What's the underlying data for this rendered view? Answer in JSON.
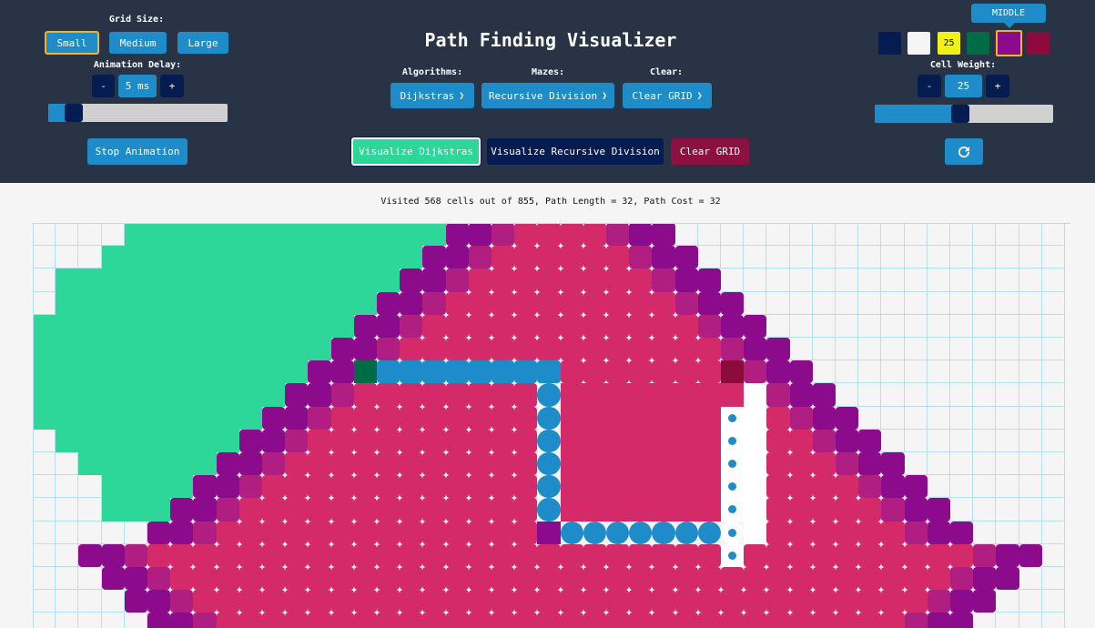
{
  "app": {
    "title": "Path Finding Visualizer"
  },
  "grid_size": {
    "label": "Grid Size:",
    "options": [
      "Small",
      "Medium",
      "Large"
    ],
    "selected": "Small"
  },
  "animation_delay": {
    "label": "Animation Delay:",
    "minus": "-",
    "value": "5 ms",
    "plus": "+",
    "slider_fraction": 0.12
  },
  "stop_animation": "Stop Animation",
  "menus": {
    "algorithms": {
      "label": "Algorithms:",
      "value": "Dijkstras"
    },
    "mazes": {
      "label": "Mazes:",
      "value": "Recursive Division"
    },
    "clear": {
      "label": "Clear:",
      "value": "Clear GRID"
    }
  },
  "actions": {
    "visualize": "Visualize Dijkstras",
    "maze": "Visualize Recursive Division",
    "clear": "Clear GRID"
  },
  "palette": {
    "tooltip": "MIDDLE",
    "swatches": [
      {
        "name": "start",
        "color": "#051c50",
        "text": ""
      },
      {
        "name": "empty",
        "color": "#f5f5f5",
        "text": ""
      },
      {
        "name": "weight",
        "color": "#f0f01a",
        "text": "25"
      },
      {
        "name": "target",
        "color": "#006b45",
        "text": ""
      },
      {
        "name": "middle",
        "color": "#8c0a8c",
        "text": ""
      },
      {
        "name": "end",
        "color": "#8c0a3c",
        "text": ""
      }
    ],
    "selected": "middle"
  },
  "cell_weight": {
    "label": "Cell Weight:",
    "minus": "-",
    "value": "25",
    "plus": "+",
    "slider_fraction": 0.48
  },
  "reset_icon": "refresh-icon",
  "status": "Visited 568 cells out of 855, Path Length = 32, Path Cost = 32",
  "colors": {
    "topbar": "#283446",
    "accent": "#1e8cc8",
    "visited_green": "#2dd699",
    "visited_pink": "#d52a6a",
    "visited_magenta": "#b01e82",
    "frontier_purple": "#8c0a8c",
    "path_blue": "#1e8cc8",
    "wall_border": "#b6dff0"
  },
  "grid": {
    "cols": 45,
    "visible_rows": 18,
    "green_rows": [
      [
        0,
        19
      ],
      [
        0,
        18
      ],
      [
        0,
        17
      ],
      [
        0,
        16
      ],
      [
        0,
        15
      ],
      [
        0,
        14
      ],
      [
        0,
        13
      ],
      [
        0,
        12
      ],
      [
        0,
        11
      ],
      [
        0,
        10
      ],
      [
        0,
        9
      ],
      [
        0,
        8
      ],
      [
        0,
        7
      ],
      [
        0,
        6
      ],
      [
        0,
        5
      ],
      [
        0,
        4
      ],
      [
        0,
        3
      ],
      [
        0,
        2
      ]
    ],
    "green_left_cut": [
      4,
      3,
      1,
      1,
      0,
      0,
      0,
      0,
      0,
      1,
      2,
      3,
      3,
      5,
      5,
      7,
      8,
      9
    ],
    "path_dots": [
      [
        8,
        30
      ],
      [
        9,
        30
      ],
      [
        10,
        30
      ],
      [
        11,
        30
      ],
      [
        12,
        30
      ],
      [
        13,
        30
      ],
      [
        14,
        30
      ]
    ],
    "wall_start": [
      6,
      14
    ],
    "goal": [
      6,
      30
    ]
  }
}
